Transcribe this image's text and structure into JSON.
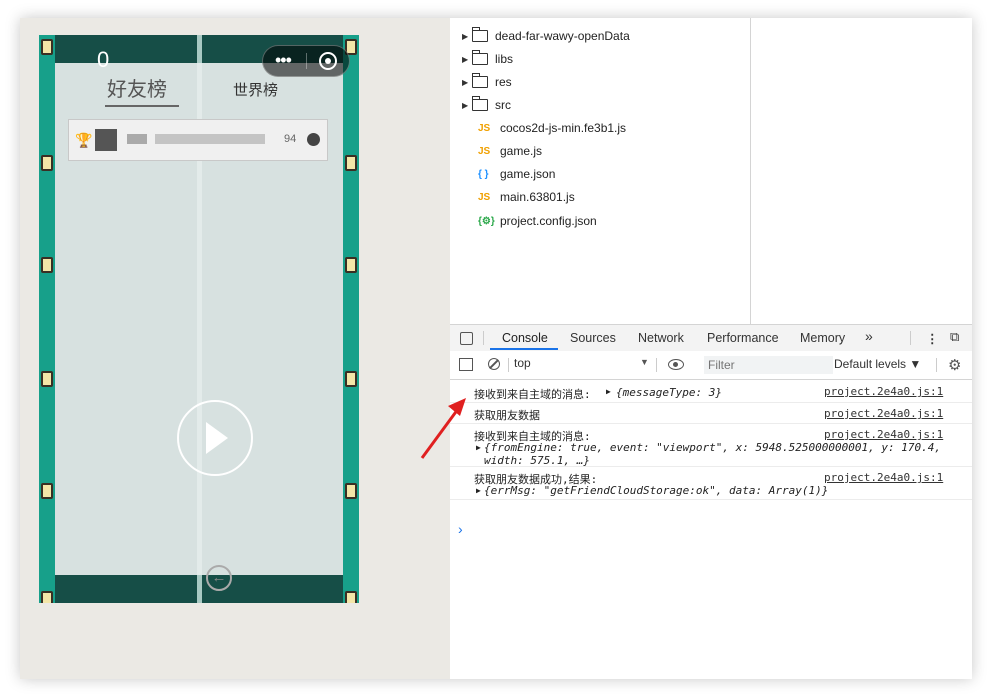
{
  "game": {
    "score": "0",
    "tabs": {
      "friends": "好友榜",
      "world": "世界榜"
    },
    "rank_row": {
      "score": "94"
    }
  },
  "files": [
    {
      "type": "folder",
      "name": "dead-far-wawy-openData"
    },
    {
      "type": "folder",
      "name": "libs"
    },
    {
      "type": "folder",
      "name": "res"
    },
    {
      "type": "folder",
      "name": "src"
    },
    {
      "type": "js",
      "name": "cocos2d-js-min.fe3b1.js"
    },
    {
      "type": "js",
      "name": "game.js"
    },
    {
      "type": "json",
      "name": "game.json"
    },
    {
      "type": "js",
      "name": "main.63801.js"
    },
    {
      "type": "cfg",
      "name": "project.config.json"
    }
  ],
  "devtools": {
    "tabs": [
      "Console",
      "Sources",
      "Network",
      "Performance",
      "Memory"
    ],
    "more": "»",
    "context": "top",
    "filter_placeholder": "Filter",
    "levels": "Default levels ▼"
  },
  "logs": [
    {
      "msg": "接收到来自主域的消息:",
      "obj": "{messageType: 3}",
      "src": "project.2e4a0.js:1"
    },
    {
      "msg": "获取朋友数据",
      "obj": "",
      "src": "project.2e4a0.js:1"
    },
    {
      "msg": "接收到来自主域的消息:",
      "obj": "{fromEngine: true, event: \"viewport\", x: 5948.525000000001, y: 170.4,",
      "obj2": "width: 575.1, …}",
      "src": "project.2e4a0.js:1"
    },
    {
      "msg": "获取朋友数据成功,结果:",
      "obj": "{errMsg: \"getFriendCloudStorage:ok\", data: Array(1)}",
      "src": "project.2e4a0.js:1"
    }
  ],
  "colors": {
    "accent": "#1a73e8",
    "arrow": "#e02020"
  }
}
